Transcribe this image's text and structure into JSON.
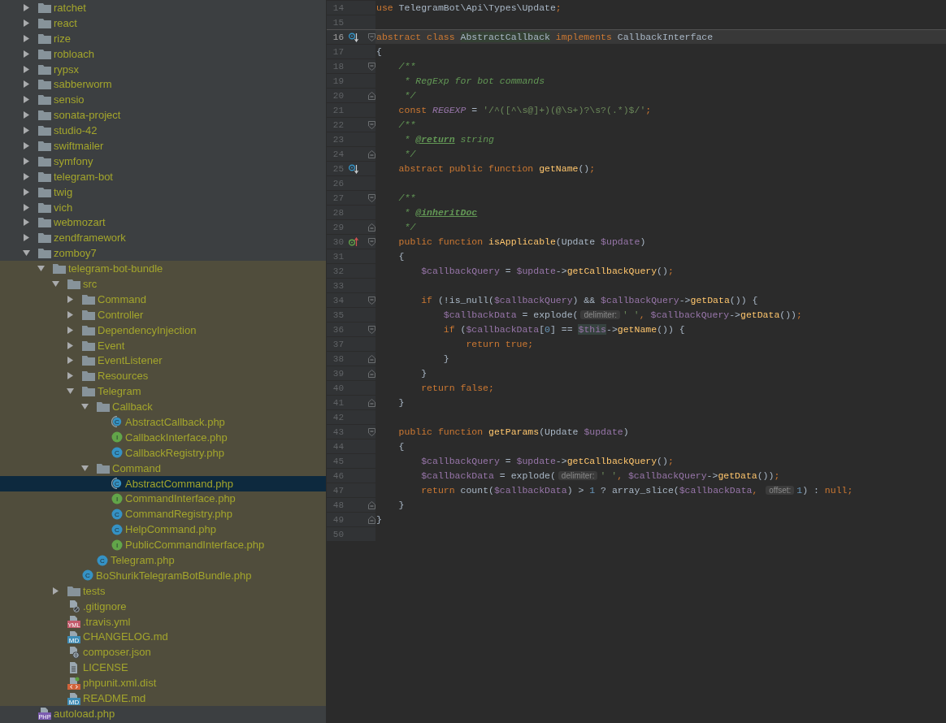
{
  "project_tree": {
    "items": [
      {
        "kind": "folder",
        "label": "ratchet",
        "expanded": false,
        "selected": false
      },
      {
        "kind": "folder",
        "label": "react",
        "expanded": false,
        "selected": false
      },
      {
        "kind": "folder",
        "label": "rize",
        "expanded": false,
        "selected": false
      },
      {
        "kind": "folder",
        "label": "robloach",
        "expanded": false,
        "selected": false
      },
      {
        "kind": "folder",
        "label": "rypsx",
        "expanded": false,
        "selected": false
      },
      {
        "kind": "folder",
        "label": "sabberworm",
        "expanded": false,
        "selected": false
      },
      {
        "kind": "folder",
        "label": "sensio",
        "expanded": false,
        "selected": false
      },
      {
        "kind": "folder",
        "label": "sonata-project",
        "expanded": false,
        "selected": false
      },
      {
        "kind": "folder",
        "label": "studio-42",
        "expanded": false,
        "selected": false
      },
      {
        "kind": "folder",
        "label": "swiftmailer",
        "expanded": false,
        "selected": false
      },
      {
        "kind": "folder",
        "label": "symfony",
        "expanded": false,
        "selected": false
      },
      {
        "kind": "folder",
        "label": "telegram-bot",
        "expanded": false,
        "selected": false
      },
      {
        "kind": "folder",
        "label": "twig",
        "expanded": false,
        "selected": false
      },
      {
        "kind": "folder",
        "label": "vich",
        "expanded": false,
        "selected": false
      },
      {
        "kind": "folder",
        "label": "webmozart",
        "expanded": false,
        "selected": false
      },
      {
        "kind": "folder",
        "label": "zendframework",
        "expanded": false,
        "selected": false
      },
      {
        "kind": "folder",
        "label": "zomboy7",
        "expanded": true,
        "selected": false,
        "children": [
          {
            "kind": "folder",
            "label": "telegram-bot-bundle",
            "expanded": true,
            "selected": false,
            "scoped": true,
            "children": [
              {
                "kind": "folder",
                "label": "src",
                "expanded": true,
                "selected": false,
                "children": [
                  {
                    "kind": "folder",
                    "label": "Command",
                    "expanded": false,
                    "selected": false
                  },
                  {
                    "kind": "folder",
                    "label": "Controller",
                    "expanded": false,
                    "selected": false
                  },
                  {
                    "kind": "folder",
                    "label": "DependencyInjection",
                    "expanded": false,
                    "selected": false
                  },
                  {
                    "kind": "folder",
                    "label": "Event",
                    "expanded": false,
                    "selected": false
                  },
                  {
                    "kind": "folder",
                    "label": "EventListener",
                    "expanded": false,
                    "selected": false
                  },
                  {
                    "kind": "folder",
                    "label": "Resources",
                    "expanded": false,
                    "selected": false
                  },
                  {
                    "kind": "folder",
                    "label": "Telegram",
                    "expanded": true,
                    "selected": false,
                    "children": [
                      {
                        "kind": "folder",
                        "label": "Callback",
                        "expanded": true,
                        "selected": false,
                        "children": [
                          {
                            "kind": "abstract-class",
                            "badge": "C",
                            "label": "AbstractCallback.php",
                            "selected": false
                          },
                          {
                            "kind": "interface",
                            "badge": "I",
                            "label": "CallbackInterface.php",
                            "selected": false
                          },
                          {
                            "kind": "class",
                            "badge": "C",
                            "label": "CallbackRegistry.php",
                            "selected": false
                          }
                        ]
                      },
                      {
                        "kind": "folder",
                        "label": "Command",
                        "expanded": true,
                        "selected": false,
                        "children": [
                          {
                            "kind": "abstract-class",
                            "badge": "C",
                            "label": "AbstractCommand.php",
                            "selected": true
                          },
                          {
                            "kind": "interface",
                            "badge": "I",
                            "label": "CommandInterface.php",
                            "selected": false
                          },
                          {
                            "kind": "class",
                            "badge": "C",
                            "label": "CommandRegistry.php",
                            "selected": false
                          },
                          {
                            "kind": "class",
                            "badge": "C",
                            "label": "HelpCommand.php",
                            "selected": false
                          },
                          {
                            "kind": "interface",
                            "badge": "I",
                            "label": "PublicCommandInterface.php",
                            "selected": false
                          }
                        ]
                      },
                      {
                        "kind": "class",
                        "badge": "C",
                        "label": "Telegram.php",
                        "selected": false
                      }
                    ]
                  },
                  {
                    "kind": "class",
                    "badge": "C",
                    "label": "BoShurikTelegramBotBundle.php",
                    "selected": false
                  }
                ]
              },
              {
                "kind": "folder",
                "label": "tests",
                "expanded": false,
                "selected": false
              },
              {
                "kind": "ignore",
                "label": ".gitignore",
                "selected": false
              },
              {
                "kind": "yml",
                "badge": "YML",
                "label": ".travis.yml",
                "selected": false
              },
              {
                "kind": "md",
                "badge": "MD",
                "label": "CHANGELOG.md",
                "selected": false
              },
              {
                "kind": "json",
                "label": "composer.json",
                "selected": false
              },
              {
                "kind": "text",
                "label": "LICENSE",
                "selected": false
              },
              {
                "kind": "xml",
                "label": "phpunit.xml.dist",
                "selected": false
              },
              {
                "kind": "md",
                "badge": "MD",
                "label": "README.md",
                "selected": false
              }
            ]
          }
        ]
      },
      {
        "kind": "php",
        "badge": "PHP",
        "label": "autoload.php",
        "selected": false
      }
    ]
  },
  "editor": {
    "lines": [
      {
        "number": "14",
        "current": false,
        "tokens": [
          {
            "kind": "kw",
            "text": "use "
          },
          {
            "kind": "plain",
            "text": "TelegramBot\\Api\\Types\\Update"
          },
          {
            "kind": "kw",
            "text": ";"
          }
        ]
      },
      {
        "number": "15",
        "current": false
      },
      {
        "number": "16",
        "current": true,
        "separator": true,
        "marker": {
          "kind": "implemented"
        },
        "fold": {
          "kind": "start"
        },
        "tokens": [
          {
            "kind": "kw",
            "text": "abstract class "
          },
          {
            "kind": "hl",
            "text": "AbstractCallback"
          },
          {
            "kind": "kw",
            "text": " implements "
          },
          {
            "kind": "plain",
            "text": "CallbackInterface"
          }
        ]
      },
      {
        "number": "17",
        "current": false,
        "tokens": [
          {
            "kind": "plain",
            "text": "{"
          }
        ]
      },
      {
        "number": "18",
        "current": false,
        "fold": {
          "kind": "start"
        },
        "tokens": [
          {
            "kind": "comment",
            "text": "    /**"
          }
        ]
      },
      {
        "number": "19",
        "current": false,
        "tokens": [
          {
            "kind": "comment",
            "text": "     * RegExp for bot commands"
          }
        ]
      },
      {
        "number": "20",
        "current": false,
        "fold": {
          "kind": "end"
        },
        "tokens": [
          {
            "kind": "comment",
            "text": "     */"
          }
        ]
      },
      {
        "number": "21",
        "current": false,
        "tokens": [
          {
            "kind": "kw",
            "text": "    const "
          },
          {
            "kind": "const",
            "text": "REGEXP"
          },
          {
            "kind": "plain",
            "text": " = "
          },
          {
            "kind": "str",
            "text": "'/^([^\\s@]+)(@\\S+)?\\s?(.*)$/'"
          },
          {
            "kind": "kw",
            "text": ";"
          }
        ]
      },
      {
        "number": "22",
        "current": false,
        "fold": {
          "kind": "start"
        },
        "tokens": [
          {
            "kind": "comment",
            "text": "    /**"
          }
        ]
      },
      {
        "number": "23",
        "current": false,
        "tokens": [
          {
            "kind": "comment",
            "text": "     * "
          },
          {
            "kind": "doctag",
            "text": "@return"
          },
          {
            "kind": "comment",
            "text": " string"
          }
        ]
      },
      {
        "number": "24",
        "current": false,
        "fold": {
          "kind": "end"
        },
        "tokens": [
          {
            "kind": "comment",
            "text": "     */"
          }
        ]
      },
      {
        "number": "25",
        "current": false,
        "marker": {
          "kind": "implemented"
        },
        "tokens": [
          {
            "kind": "kw",
            "text": "    abstract public function "
          },
          {
            "kind": "fn",
            "text": "getName"
          },
          {
            "kind": "plain",
            "text": "()"
          },
          {
            "kind": "kw",
            "text": ";"
          }
        ]
      },
      {
        "number": "26",
        "current": false
      },
      {
        "number": "27",
        "current": false,
        "fold": {
          "kind": "start"
        },
        "tokens": [
          {
            "kind": "comment",
            "text": "    /**"
          }
        ]
      },
      {
        "number": "28",
        "current": false,
        "tokens": [
          {
            "kind": "comment",
            "text": "     * "
          },
          {
            "kind": "doctag",
            "text": "@inheritDoc"
          }
        ]
      },
      {
        "number": "29",
        "current": false,
        "fold": {
          "kind": "end"
        },
        "tokens": [
          {
            "kind": "comment",
            "text": "     */"
          }
        ]
      },
      {
        "number": "30",
        "current": false,
        "marker": {
          "kind": "overriding"
        },
        "fold": {
          "kind": "start"
        },
        "tokens": [
          {
            "kind": "kw",
            "text": "    public function "
          },
          {
            "kind": "fn",
            "text": "isApplicable"
          },
          {
            "kind": "plain",
            "text": "(Update "
          },
          {
            "kind": "var",
            "text": "$update"
          },
          {
            "kind": "plain",
            "text": ")"
          }
        ]
      },
      {
        "number": "31",
        "current": false,
        "tokens": [
          {
            "kind": "plain",
            "text": "    {"
          }
        ]
      },
      {
        "number": "32",
        "current": false,
        "tokens": [
          {
            "kind": "var",
            "text": "        $callbackQuery"
          },
          {
            "kind": "plain",
            "text": " = "
          },
          {
            "kind": "var",
            "text": "$update"
          },
          {
            "kind": "plain",
            "text": "->"
          },
          {
            "kind": "fn",
            "text": "getCallbackQuery"
          },
          {
            "kind": "plain",
            "text": "()"
          },
          {
            "kind": "kw",
            "text": ";"
          }
        ]
      },
      {
        "number": "33",
        "current": false
      },
      {
        "number": "34",
        "current": false,
        "fold": {
          "kind": "start"
        },
        "tokens": [
          {
            "kind": "kw",
            "text": "        if "
          },
          {
            "kind": "plain",
            "text": "(!is_null("
          },
          {
            "kind": "var",
            "text": "$callbackQuery"
          },
          {
            "kind": "plain",
            "text": ") && "
          },
          {
            "kind": "var",
            "text": "$callbackQuery"
          },
          {
            "kind": "plain",
            "text": "->"
          },
          {
            "kind": "fn",
            "text": "getData"
          },
          {
            "kind": "plain",
            "text": "()) {"
          }
        ]
      },
      {
        "number": "35",
        "current": false,
        "tokens": [
          {
            "kind": "var",
            "text": "            $callbackData"
          },
          {
            "kind": "plain",
            "text": " = explode("
          },
          {
            "kind": "hint",
            "text": "delimiter:"
          },
          {
            "kind": "str",
            "text": "' '"
          },
          {
            "kind": "kw",
            "text": ", "
          },
          {
            "kind": "var",
            "text": "$callbackQuery"
          },
          {
            "kind": "plain",
            "text": "->"
          },
          {
            "kind": "fn",
            "text": "getData"
          },
          {
            "kind": "plain",
            "text": "())"
          },
          {
            "kind": "kw",
            "text": ";"
          }
        ]
      },
      {
        "number": "36",
        "current": false,
        "fold": {
          "kind": "start"
        },
        "tokens": [
          {
            "kind": "kw",
            "text": "            if "
          },
          {
            "kind": "plain",
            "text": "("
          },
          {
            "kind": "var",
            "text": "$callbackData"
          },
          {
            "kind": "plain",
            "text": "["
          },
          {
            "kind": "num",
            "text": "0"
          },
          {
            "kind": "plain",
            "text": "] == "
          },
          {
            "kind": "this",
            "text": "$this"
          },
          {
            "kind": "plain",
            "text": "->"
          },
          {
            "kind": "fn",
            "text": "getName"
          },
          {
            "kind": "plain",
            "text": "()) {"
          }
        ]
      },
      {
        "number": "37",
        "current": false,
        "tokens": [
          {
            "kind": "kw",
            "text": "                return true;"
          }
        ]
      },
      {
        "number": "38",
        "current": false,
        "fold": {
          "kind": "end"
        },
        "tokens": [
          {
            "kind": "plain",
            "text": "            }"
          }
        ]
      },
      {
        "number": "39",
        "current": false,
        "fold": {
          "kind": "end"
        },
        "tokens": [
          {
            "kind": "plain",
            "text": "        }"
          }
        ]
      },
      {
        "number": "40",
        "current": false,
        "tokens": [
          {
            "kind": "kw",
            "text": "        return false;"
          }
        ]
      },
      {
        "number": "41",
        "current": false,
        "fold": {
          "kind": "end"
        },
        "tokens": [
          {
            "kind": "plain",
            "text": "    }"
          }
        ]
      },
      {
        "number": "42",
        "current": false
      },
      {
        "number": "43",
        "current": false,
        "fold": {
          "kind": "start"
        },
        "tokens": [
          {
            "kind": "kw",
            "text": "    public function "
          },
          {
            "kind": "fn",
            "text": "getParams"
          },
          {
            "kind": "plain",
            "text": "(Update "
          },
          {
            "kind": "var",
            "text": "$update"
          },
          {
            "kind": "plain",
            "text": ")"
          }
        ]
      },
      {
        "number": "44",
        "current": false,
        "tokens": [
          {
            "kind": "plain",
            "text": "    {"
          }
        ]
      },
      {
        "number": "45",
        "current": false,
        "tokens": [
          {
            "kind": "var",
            "text": "        $callbackQuery"
          },
          {
            "kind": "plain",
            "text": " = "
          },
          {
            "kind": "var",
            "text": "$update"
          },
          {
            "kind": "plain",
            "text": "->"
          },
          {
            "kind": "fn",
            "text": "getCallbackQuery"
          },
          {
            "kind": "plain",
            "text": "()"
          },
          {
            "kind": "kw",
            "text": ";"
          }
        ]
      },
      {
        "number": "46",
        "current": false,
        "tokens": [
          {
            "kind": "var",
            "text": "        $callbackData"
          },
          {
            "kind": "plain",
            "text": " = explode("
          },
          {
            "kind": "hint",
            "text": "delimiter:"
          },
          {
            "kind": "str",
            "text": "' '"
          },
          {
            "kind": "kw",
            "text": ", "
          },
          {
            "kind": "var",
            "text": "$callbackQuery"
          },
          {
            "kind": "plain",
            "text": "->"
          },
          {
            "kind": "fn",
            "text": "getData"
          },
          {
            "kind": "plain",
            "text": "())"
          },
          {
            "kind": "kw",
            "text": ";"
          }
        ]
      },
      {
        "number": "47",
        "current": false,
        "tokens": [
          {
            "kind": "kw",
            "text": "        return "
          },
          {
            "kind": "plain",
            "text": "count("
          },
          {
            "kind": "var",
            "text": "$callbackData"
          },
          {
            "kind": "plain",
            "text": ") > "
          },
          {
            "kind": "num",
            "text": "1"
          },
          {
            "kind": "plain",
            "text": " ? array_slice("
          },
          {
            "kind": "var",
            "text": "$callbackData"
          },
          {
            "kind": "kw",
            "text": ", "
          },
          {
            "kind": "hint",
            "text": "offset:"
          },
          {
            "kind": "num",
            "text": "1"
          },
          {
            "kind": "plain",
            "text": ") : "
          },
          {
            "kind": "kw",
            "text": "null;"
          }
        ]
      },
      {
        "number": "48",
        "current": false,
        "fold": {
          "kind": "end"
        },
        "tokens": [
          {
            "kind": "plain",
            "text": "    }"
          }
        ]
      },
      {
        "number": "49",
        "current": false,
        "fold": {
          "kind": "end"
        },
        "tokens": [
          {
            "kind": "plain",
            "text": "}"
          }
        ]
      },
      {
        "number": "50",
        "current": false
      }
    ]
  }
}
